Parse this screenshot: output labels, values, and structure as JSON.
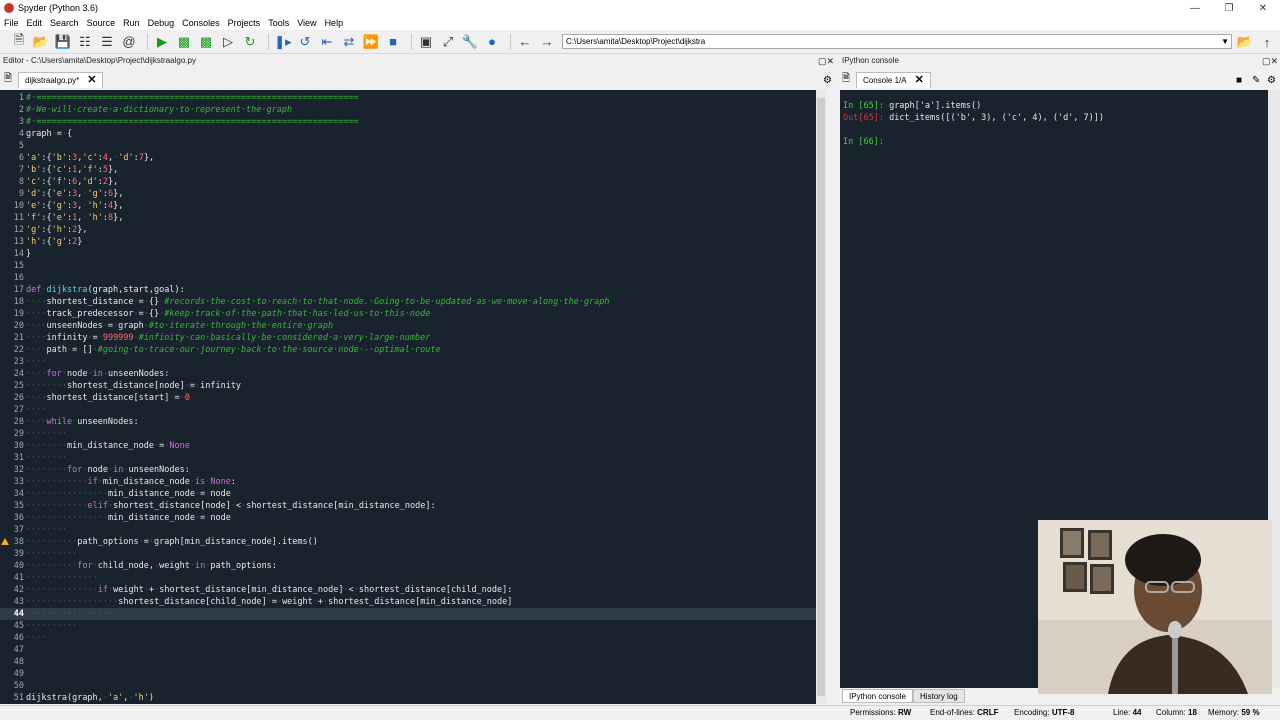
{
  "window": {
    "title": "Spyder (Python 3.6)"
  },
  "menu": [
    "File",
    "Edit",
    "Search",
    "Source",
    "Run",
    "Debug",
    "Consoles",
    "Projects",
    "Tools",
    "View",
    "Help"
  ],
  "toolbar": {
    "path": "C:\\Users\\amita\\Desktop\\Project\\dijkstra"
  },
  "editor": {
    "label": "Editor - C:\\Users\\amita\\Desktop\\Project\\dijkstraalgo.py",
    "tab": "dijkstraalgo.py*",
    "current_line": 44,
    "lines": [
      {
        "n": "1",
        "t": "# ==============================================================="
      },
      {
        "n": "2",
        "t": "# We will create a dictionary to represent the graph"
      },
      {
        "n": "3",
        "t": "# ==============================================================="
      },
      {
        "n": "4",
        "t": "graph = {"
      },
      {
        "n": "5",
        "t": ""
      },
      {
        "n": "6",
        "t": "'a':{'b':3,'c':4, 'd':7},"
      },
      {
        "n": "7",
        "t": "'b':{'c':1,'f':5},"
      },
      {
        "n": "8",
        "t": "'c':{'f':6,'d':2},"
      },
      {
        "n": "9",
        "t": "'d':{'e':3, 'g':6},"
      },
      {
        "n": "10",
        "t": "'e':{'g':3, 'h':4},"
      },
      {
        "n": "11",
        "t": "'f':{'e':1, 'h':8},"
      },
      {
        "n": "12",
        "t": "'g':{'h':2},"
      },
      {
        "n": "13",
        "t": "'h':{'g':2}"
      },
      {
        "n": "14",
        "t": "}"
      },
      {
        "n": "15",
        "t": ""
      },
      {
        "n": "16",
        "t": ""
      },
      {
        "n": "17",
        "t": "def dijkstra(graph,start,goal):"
      },
      {
        "n": "18",
        "t": "    shortest_distance = {} #records the cost to reach to that node. Going to be updated as we move along the graph"
      },
      {
        "n": "19",
        "t": "    track_predecessor = {} #keep track of the path that has led us to this node"
      },
      {
        "n": "20",
        "t": "    unseenNodes = graph #to iterate through the entire graph"
      },
      {
        "n": "21",
        "t": "    infinity = 999999 #infinity can basically be considered a very large number"
      },
      {
        "n": "22",
        "t": "    path = [] #going to trace our journey back to the source node - optimal route"
      },
      {
        "n": "23",
        "t": "    "
      },
      {
        "n": "24",
        "t": "    for node in unseenNodes:"
      },
      {
        "n": "25",
        "t": "        shortest_distance[node] = infinity"
      },
      {
        "n": "26",
        "t": "    shortest_distance[start] = 0"
      },
      {
        "n": "27",
        "t": "    "
      },
      {
        "n": "28",
        "t": "    while unseenNodes:"
      },
      {
        "n": "29",
        "t": "        "
      },
      {
        "n": "30",
        "t": "        min_distance_node = None"
      },
      {
        "n": "31",
        "t": "        "
      },
      {
        "n": "32",
        "t": "        for node in unseenNodes:"
      },
      {
        "n": "33",
        "t": "            if min_distance_node is None:"
      },
      {
        "n": "34",
        "t": "                min_distance_node = node"
      },
      {
        "n": "35",
        "t": "            elif shortest_distance[node] < shortest_distance[min_distance_node]:"
      },
      {
        "n": "36",
        "t": "                min_distance_node = node"
      },
      {
        "n": "37",
        "t": "        "
      },
      {
        "n": "38",
        "t": "          path_options = graph[min_distance_node].items()"
      },
      {
        "n": "39",
        "t": "          "
      },
      {
        "n": "40",
        "t": "          for child_node, weight in path_options:"
      },
      {
        "n": "41",
        "t": "              "
      },
      {
        "n": "42",
        "t": "              if weight + shortest_distance[min_distance_node] < shortest_distance[child_node]:"
      },
      {
        "n": "43",
        "t": "                  shortest_distance[child_node] = weight + shortest_distance[min_distance_node]"
      },
      {
        "n": "44",
        "t": "                  "
      },
      {
        "n": "45",
        "t": "          "
      },
      {
        "n": "46",
        "t": "    "
      },
      {
        "n": "47",
        "t": ""
      },
      {
        "n": "48",
        "t": ""
      },
      {
        "n": "49",
        "t": ""
      },
      {
        "n": "50",
        "t": ""
      },
      {
        "n": "51",
        "t": "dijkstra(graph, 'a', 'h')"
      }
    ]
  },
  "console": {
    "label": "IPython console",
    "tab": "Console 1/A",
    "lines": [
      {
        "prompt": "In [65]:",
        "kind": "in",
        "text": " graph['a'].items()"
      },
      {
        "prompt": "Out[65]:",
        "kind": "out",
        "text": " dict_items([('b', 3), ('c', 4), ('d', 7)])"
      },
      {
        "prompt": "",
        "kind": "in",
        "text": ""
      },
      {
        "prompt": "In [66]:",
        "kind": "in",
        "text": ""
      }
    ],
    "bottom_tabs": [
      "IPython console",
      "History log"
    ]
  },
  "status": {
    "permissions_label": "Permissions:",
    "permissions": "RW",
    "eol_label": "End-of-lines:",
    "eol": "CRLF",
    "encoding_label": "Encoding:",
    "encoding": "UTF-8",
    "line_label": "Line:",
    "line": "44",
    "column_label": "Column:",
    "column": "18",
    "memory_label": "Memory:",
    "memory": "59 %"
  },
  "colors": {
    "editor_bg": "#19232d",
    "keyword": "#c670e0",
    "comment": "#35b835",
    "string": "#f5d067",
    "number": "#ff6a6a",
    "func": "#57d6e0"
  }
}
